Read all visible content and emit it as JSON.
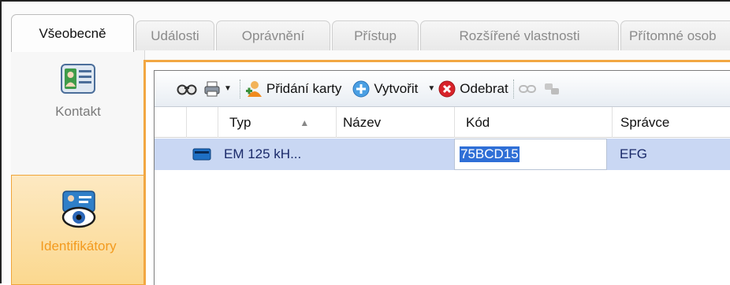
{
  "tabs": [
    {
      "label": "Všeobecně",
      "active": true
    },
    {
      "label": "Události"
    },
    {
      "label": "Oprávnění"
    },
    {
      "label": "Přístup"
    },
    {
      "label": "Rozšířené vlastnosti"
    },
    {
      "label": "Přítomné osob"
    }
  ],
  "sidebar": {
    "items": [
      {
        "label": "Kontakt",
        "icon": "contact-card-icon"
      },
      {
        "label": "Identifikátory",
        "icon": "identifier-eye-icon",
        "selected": true
      }
    ]
  },
  "toolbar": {
    "add_card_label": "Přidání karty",
    "create_label": "Vytvořit",
    "remove_label": "Odebrat",
    "icons": [
      "view-icon",
      "print-icon",
      "add-card-icon",
      "create-icon",
      "remove-icon",
      "link-icon",
      "unlink-icon"
    ]
  },
  "grid": {
    "columns": [
      "Typ",
      "Název",
      "Kód",
      "Správce"
    ],
    "sorted_column": "Typ",
    "rows": [
      {
        "typ": "EM 125 kH...",
        "nazev": "",
        "kod": "75BCD15",
        "spravce": "EFG"
      }
    ]
  },
  "colors": {
    "accent_orange": "#f2a742",
    "selection_row": "#c9d7f3",
    "text_selection": "#2f6fd6"
  }
}
